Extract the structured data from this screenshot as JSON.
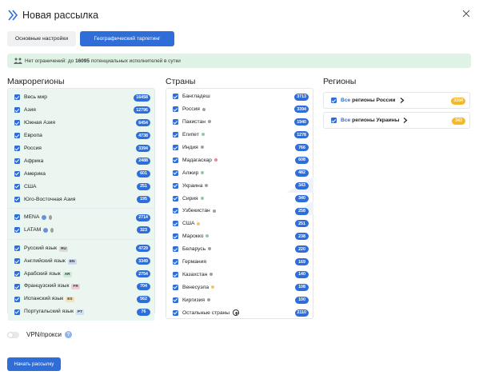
{
  "header": {
    "title": "Новая рассылка"
  },
  "tabs": [
    {
      "label": "Основные настройки",
      "active": false
    },
    {
      "label": "Географический таргетинг",
      "active": true
    }
  ],
  "info": {
    "prefix": "Нет ограничений: до",
    "count": "16095",
    "suffix": "потенциальных исполнителей в сутки"
  },
  "macroregions": {
    "title": "Макрорегионы",
    "groups": [
      [
        {
          "label": "Весь мир",
          "count": "16458"
        },
        {
          "label": "Азия",
          "count": "12796"
        },
        {
          "label": "Южная Азия",
          "count": "6454"
        },
        {
          "label": "Европа",
          "count": "4738"
        },
        {
          "label": "Россия",
          "count": "3394"
        },
        {
          "label": "Африка",
          "count": "2488"
        },
        {
          "label": "Америка",
          "count": "601"
        },
        {
          "label": "США",
          "count": "251"
        },
        {
          "label": "Юго-Восточная Азия",
          "count": "195"
        }
      ],
      [
        {
          "label": "MENA",
          "count": "2714"
        },
        {
          "label": "LATAM",
          "count": "323"
        }
      ],
      [
        {
          "label": "Русский язык",
          "tag": "RU",
          "tag_color": "#d9dadc",
          "count": "4729"
        },
        {
          "label": "Английский язык",
          "tag": "EN",
          "tag_color": "#cdd9ef",
          "count": "3349"
        },
        {
          "label": "Арабский язык",
          "tag": "AR",
          "tag_color": "#cfead8",
          "count": "2754"
        },
        {
          "label": "Французский язык",
          "tag": "FR",
          "tag_color": "#f4cdd2",
          "count": "704"
        },
        {
          "label": "Испанский язык",
          "tag": "ES",
          "tag_color": "#f7e2b5",
          "count": "562"
        },
        {
          "label": "Португальский язык",
          "tag": "PT",
          "tag_color": "#cfe0f5",
          "count": "76"
        }
      ]
    ]
  },
  "countries": {
    "title": "Страны",
    "items": [
      {
        "label": "Бангладеш",
        "count": "3713",
        "dot": ""
      },
      {
        "label": "Россия",
        "count": "3394",
        "dot": "#9aa0a6"
      },
      {
        "label": "Пакистан",
        "count": "1940",
        "dot": "#9aa0a6"
      },
      {
        "label": "Египет",
        "count": "1278",
        "dot": "#8fc9a3"
      },
      {
        "label": "Индия",
        "count": "766",
        "dot": "#9aa0a6"
      },
      {
        "label": "Мадагаскар",
        "count": "608",
        "dot": "#e58a95"
      },
      {
        "label": "Алжир",
        "count": "482",
        "dot": "#8fc9a3"
      },
      {
        "label": "Украина",
        "count": "343",
        "dot": "#9aa0a6"
      },
      {
        "label": "Сирия",
        "count": "340",
        "dot": "#8fc9a3"
      },
      {
        "label": "Узбекистан",
        "count": "258",
        "dot": "#9aa0a6"
      },
      {
        "label": "США",
        "count": "251",
        "dot": "#f0c66b"
      },
      {
        "label": "Марокко",
        "count": "238",
        "dot": "#8fc9a3"
      },
      {
        "label": "Беларусь",
        "count": "220",
        "dot": "#9aa0a6"
      },
      {
        "label": "Германия",
        "count": "169",
        "dot": ""
      },
      {
        "label": "Казахстан",
        "count": "140",
        "dot": "#9aa0a6"
      },
      {
        "label": "Венесуэла",
        "count": "108",
        "dot": "#f0c66b"
      },
      {
        "label": "Киргизия",
        "count": "100",
        "dot": "#9aa0a6"
      },
      {
        "label": "Остальные страны",
        "count": "2110",
        "dot": ""
      }
    ]
  },
  "regions": {
    "title": "Регионы",
    "items": [
      {
        "prefix": "Все",
        "label": "регионы России",
        "count": "3394"
      },
      {
        "prefix": "Все",
        "label": "регионы Украины",
        "count": "343"
      }
    ]
  },
  "vpn": {
    "label": "VPN/прокси",
    "help": "?"
  },
  "start_button": "Начать рассылку",
  "colors": {
    "accent": "#2f6ed8",
    "badge_orange": "#f3b928",
    "info_bg": "#dff2e6",
    "macro_bg": "#eaf6ef"
  }
}
